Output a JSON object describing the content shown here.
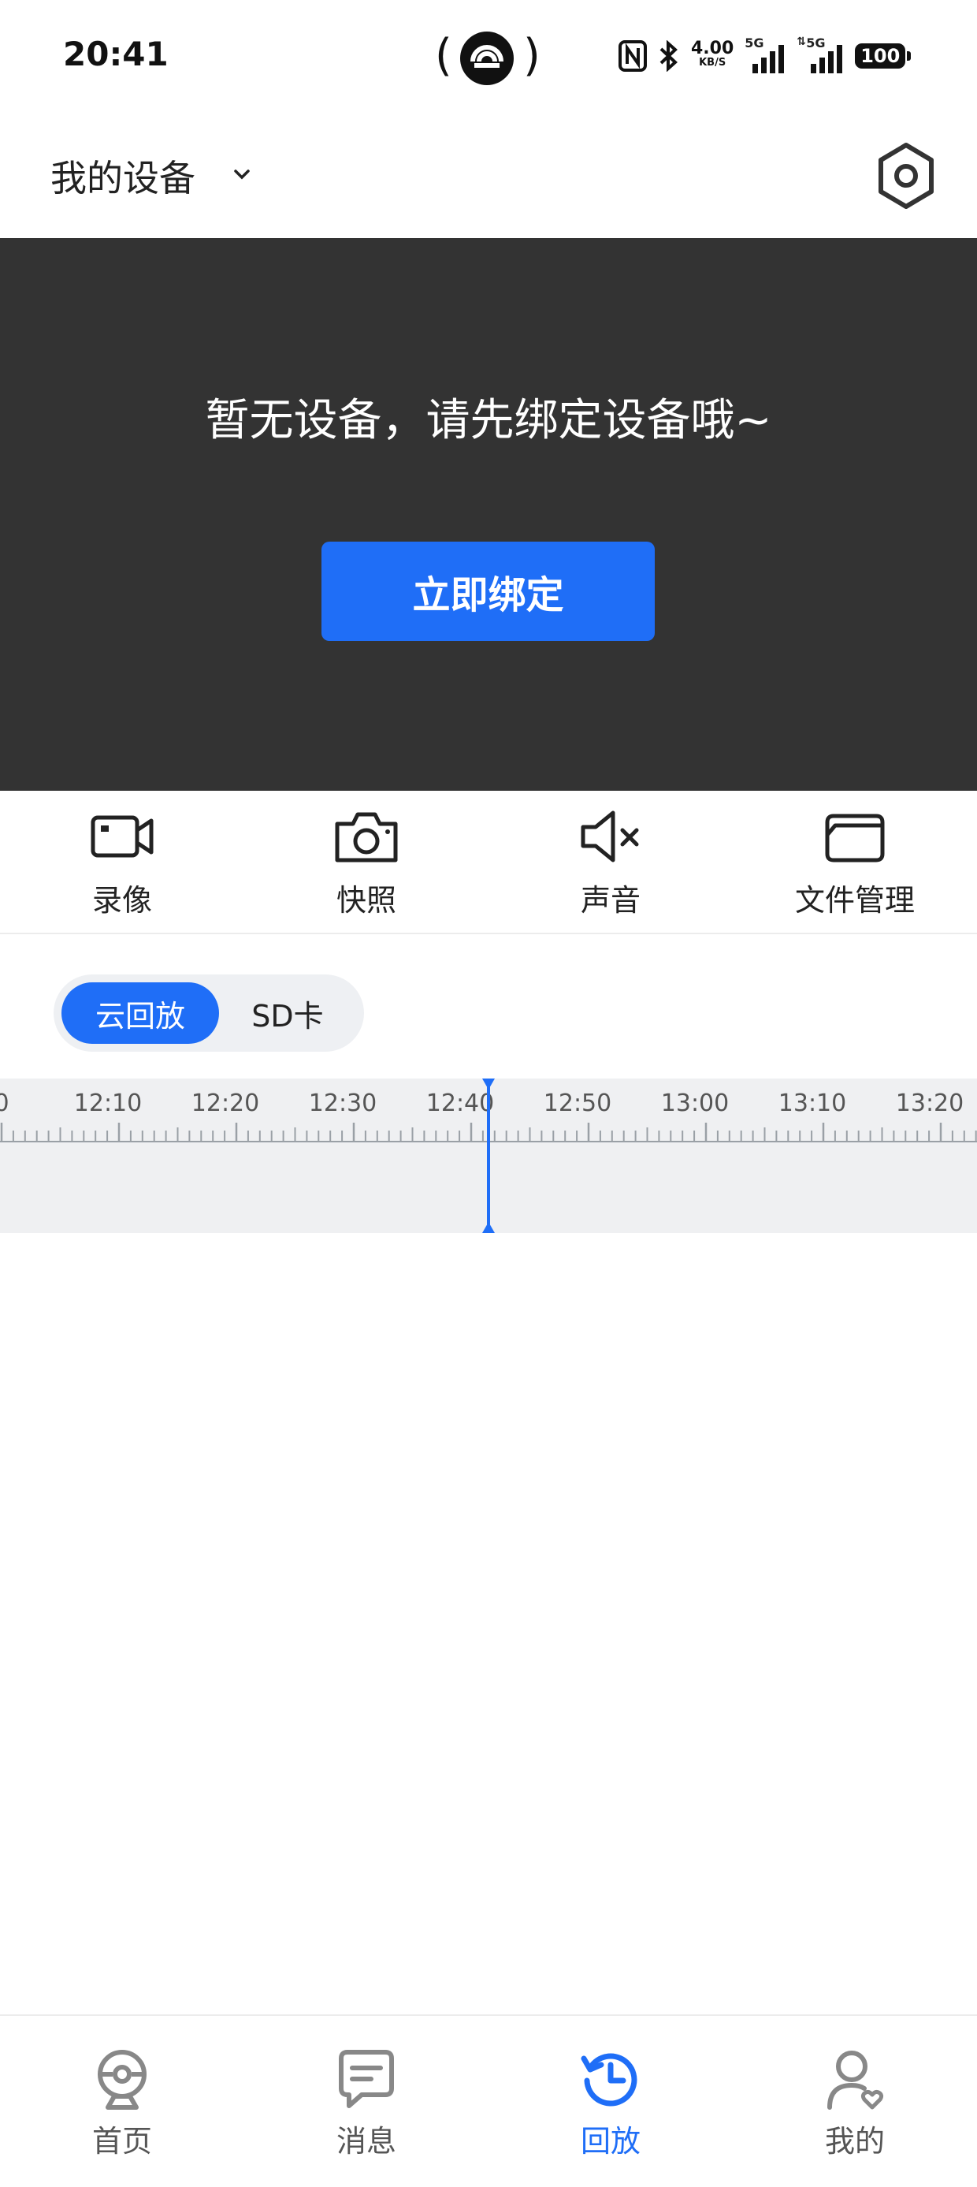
{
  "status_bar": {
    "time": "20:41",
    "net_speed_value": "4.00",
    "net_speed_unit": "KB/S",
    "network_1": "5G",
    "network_2": "5G",
    "battery": "100",
    "icons": [
      "hotspot-icon",
      "nfc-icon",
      "bluetooth-icon",
      "signal-icon",
      "signal-icon",
      "battery-icon"
    ]
  },
  "header": {
    "title": "我的设备",
    "dropdown_icon": "chevron-down-icon",
    "settings_icon": "settings-hex-icon"
  },
  "video_panel": {
    "empty_message": "暂无设备，请先绑定设备哦~",
    "bind_button": "立即绑定",
    "background_color": "#333333"
  },
  "tools": [
    {
      "label": "录像",
      "icon": "video-camera-icon"
    },
    {
      "label": "快照",
      "icon": "camera-icon"
    },
    {
      "label": "声音",
      "icon": "speaker-mute-icon"
    },
    {
      "label": "文件管理",
      "icon": "folder-icon"
    }
  ],
  "playback": {
    "tabs": [
      {
        "label": "云回放",
        "selected": true
      },
      {
        "label": "SD卡",
        "selected": false
      }
    ],
    "timeline": {
      "tick_labels": [
        "0",
        "12:10",
        "12:20",
        "12:30",
        "12:40",
        "12:50",
        "13:00",
        "13:10",
        "13:20"
      ],
      "current_time_marker": "12:40"
    }
  },
  "bottom_nav": [
    {
      "label": "首页",
      "icon": "webcam-icon",
      "active": false
    },
    {
      "label": "消息",
      "icon": "message-icon",
      "active": false
    },
    {
      "label": "回放",
      "icon": "history-icon",
      "active": true
    },
    {
      "label": "我的",
      "icon": "user-icon",
      "active": false
    }
  ],
  "colors": {
    "accent": "#1f6ef7",
    "panel": "#333333",
    "inactive": "#888888"
  }
}
